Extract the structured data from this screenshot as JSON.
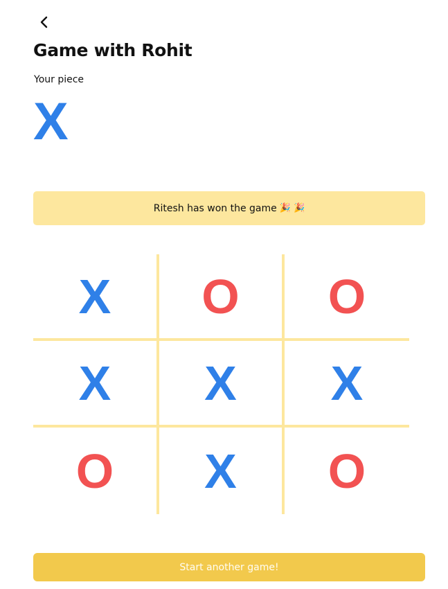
{
  "header": {
    "back_icon": "chevron-left-icon",
    "title": "Game with Rohit"
  },
  "player": {
    "label": "Your piece",
    "piece": "X"
  },
  "status": {
    "message": "Ritesh has won the game",
    "emoji": "🎉 🎉"
  },
  "board": {
    "cells": [
      [
        "X",
        "O",
        "O"
      ],
      [
        "X",
        "X",
        "X"
      ],
      [
        "O",
        "X",
        "O"
      ]
    ]
  },
  "actions": {
    "start_label": "Start another game!"
  },
  "colors": {
    "x_piece": "#2f80e8",
    "o_piece": "#f25252",
    "banner_bg": "#fde79e",
    "grid_line": "#fde79e",
    "button_bg": "#f2c94c"
  }
}
